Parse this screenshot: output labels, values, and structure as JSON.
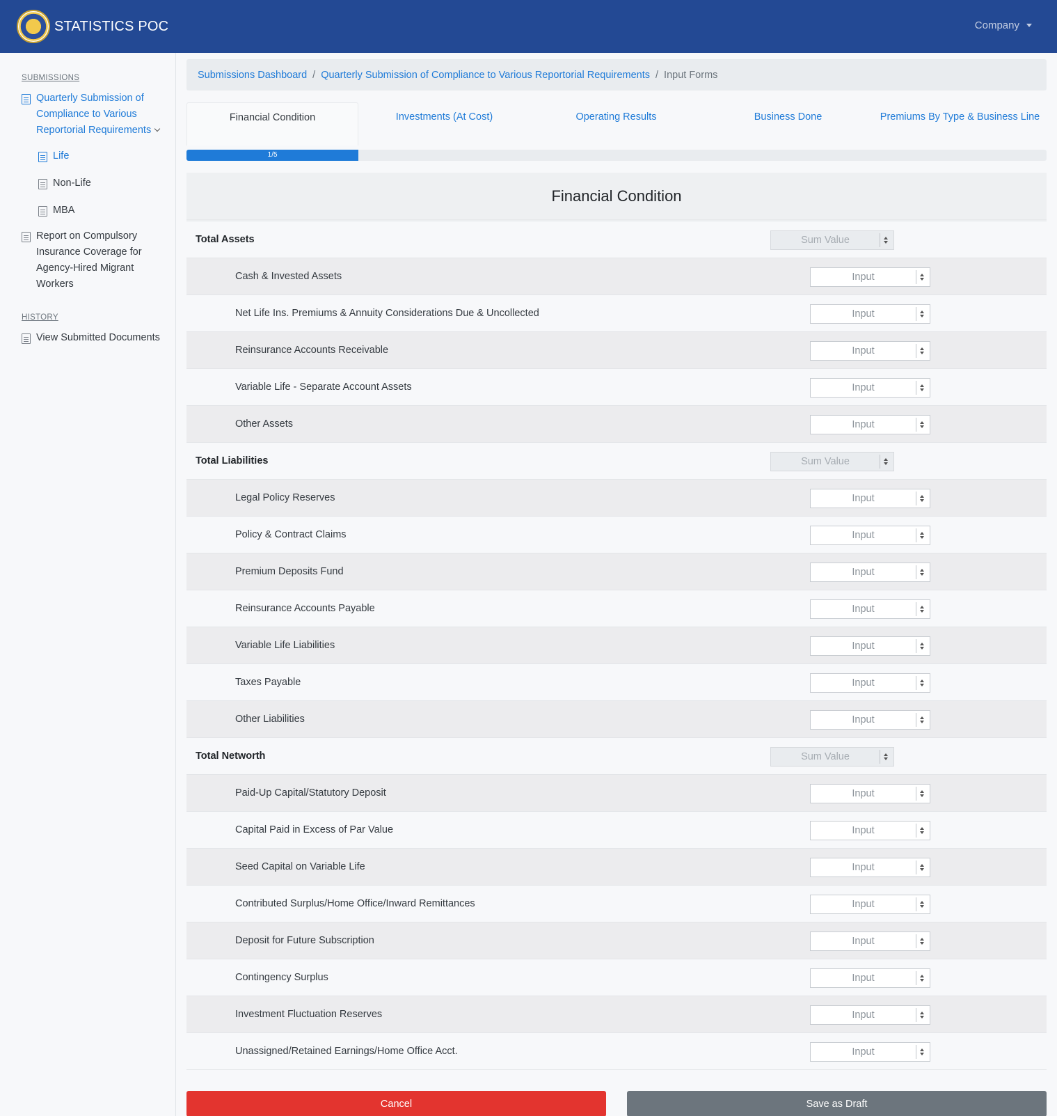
{
  "navbar": {
    "brand": "STATISTICS POC",
    "company_menu": "Company"
  },
  "sidebar": {
    "submissions_heading": "SUBMISSIONS",
    "quarterly_label": "Quarterly Submission of Compliance to Various Reportorial Requirements",
    "sub_items": [
      "Life",
      "Non-Life",
      "MBA"
    ],
    "report_label": "Report on Compulsory Insurance Coverage for Agency-Hired Migrant Workers",
    "history_heading": "HISTORY",
    "history_item": "View Submitted Documents"
  },
  "breadcrumb": {
    "items": [
      "Submissions Dashboard",
      "Quarterly Submission of Compliance to Various Reportorial Requirements"
    ],
    "current": "Input Forms"
  },
  "tabs": [
    "Financial Condition",
    "Investments (At Cost)",
    "Operating Results",
    "Business Done",
    "Premiums By Type & Business Line"
  ],
  "progress": {
    "label": "1/5",
    "current": 1,
    "total": 5
  },
  "form": {
    "title": "Financial Condition",
    "input_placeholder": "Input",
    "sum_placeholder": "Sum Value",
    "groups": [
      {
        "label": "Total Assets",
        "items": [
          "Cash & Invested Assets",
          "Net Life Ins. Premiums & Annuity Considerations Due & Uncollected",
          "Reinsurance Accounts Receivable",
          "Variable Life - Separate Account Assets",
          "Other Assets"
        ]
      },
      {
        "label": "Total Liabilities",
        "items": [
          "Legal Policy Reserves",
          "Policy & Contract Claims",
          "Premium Deposits Fund",
          "Reinsurance Accounts Payable",
          "Variable Life Liabilities",
          "Taxes Payable",
          "Other Liabilities"
        ]
      },
      {
        "label": "Total Networth",
        "items": [
          "Paid-Up Capital/Statutory Deposit",
          "Capital Paid in Excess of Par Value",
          "Seed Capital on Variable Life",
          "Contributed Surplus/Home Office/Inward Remittances",
          "Deposit for Future Subscription",
          "Contingency Surplus",
          "Investment Fluctuation Reserves",
          "Unassigned/Retained Earnings/Home Office Acct."
        ]
      }
    ]
  },
  "actions": {
    "cancel": "Cancel",
    "save_draft": "Save as Draft"
  },
  "colors": {
    "navbar": "#234994",
    "link": "#1f7bd8",
    "cancel": "#e3342f",
    "draft": "#6c757d"
  }
}
